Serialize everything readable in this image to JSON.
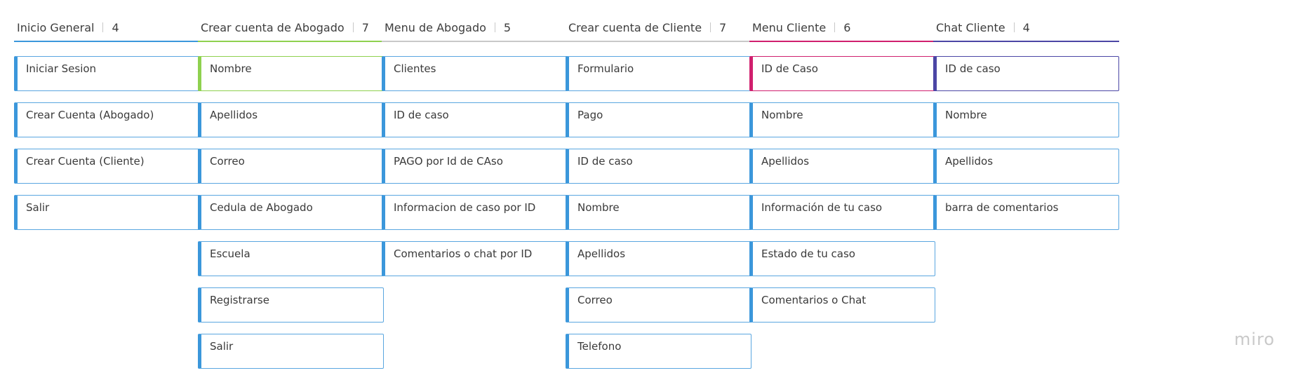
{
  "board": {
    "columns": [
      {
        "title": "Inicio General",
        "count": "4",
        "accent": "#3b97db",
        "active_card": -1,
        "cards": [
          "Iniciar Sesion",
          "Crear Cuenta (Abogado)",
          "Crear Cuenta (Cliente)",
          "Salir"
        ]
      },
      {
        "title": "Crear cuenta de Abogado",
        "count": "7",
        "accent": "#8fd14f",
        "active_card": 0,
        "cards": [
          "Nombre",
          "Apellidos",
          "Correo",
          "Cedula de Abogado",
          "Escuela",
          "Registrarse",
          "Salir"
        ]
      },
      {
        "title": "Menu de Abogado",
        "count": "5",
        "accent": "#c8c8c8",
        "active_card": -1,
        "cards": [
          "Clientes",
          "ID de caso",
          "PAGO por Id de CAso",
          "Informacion de caso por ID",
          "Comentarios o chat por ID"
        ]
      },
      {
        "title": "Crear cuenta de Cliente",
        "count": "7",
        "accent": "#c8c8c8",
        "active_card": -1,
        "cards": [
          "Formulario",
          "Pago",
          "ID de caso",
          "Nombre",
          "Apellidos",
          "Correo",
          "Telefono"
        ]
      },
      {
        "title": "Menu Cliente",
        "count": "6",
        "accent": "#d01f6e",
        "active_card": 0,
        "cards": [
          "ID de Caso",
          "Nombre",
          "Apellidos",
          "Información de tu caso",
          "Estado de tu caso",
          "Comentarios o Chat"
        ]
      },
      {
        "title": "Chat Cliente",
        "count": "4",
        "accent": "#4b46a5",
        "active_card": 0,
        "cards": [
          "ID de caso",
          "Nombre",
          "Apellidos",
          "barra de comentarios"
        ]
      }
    ]
  },
  "watermark": "miro"
}
